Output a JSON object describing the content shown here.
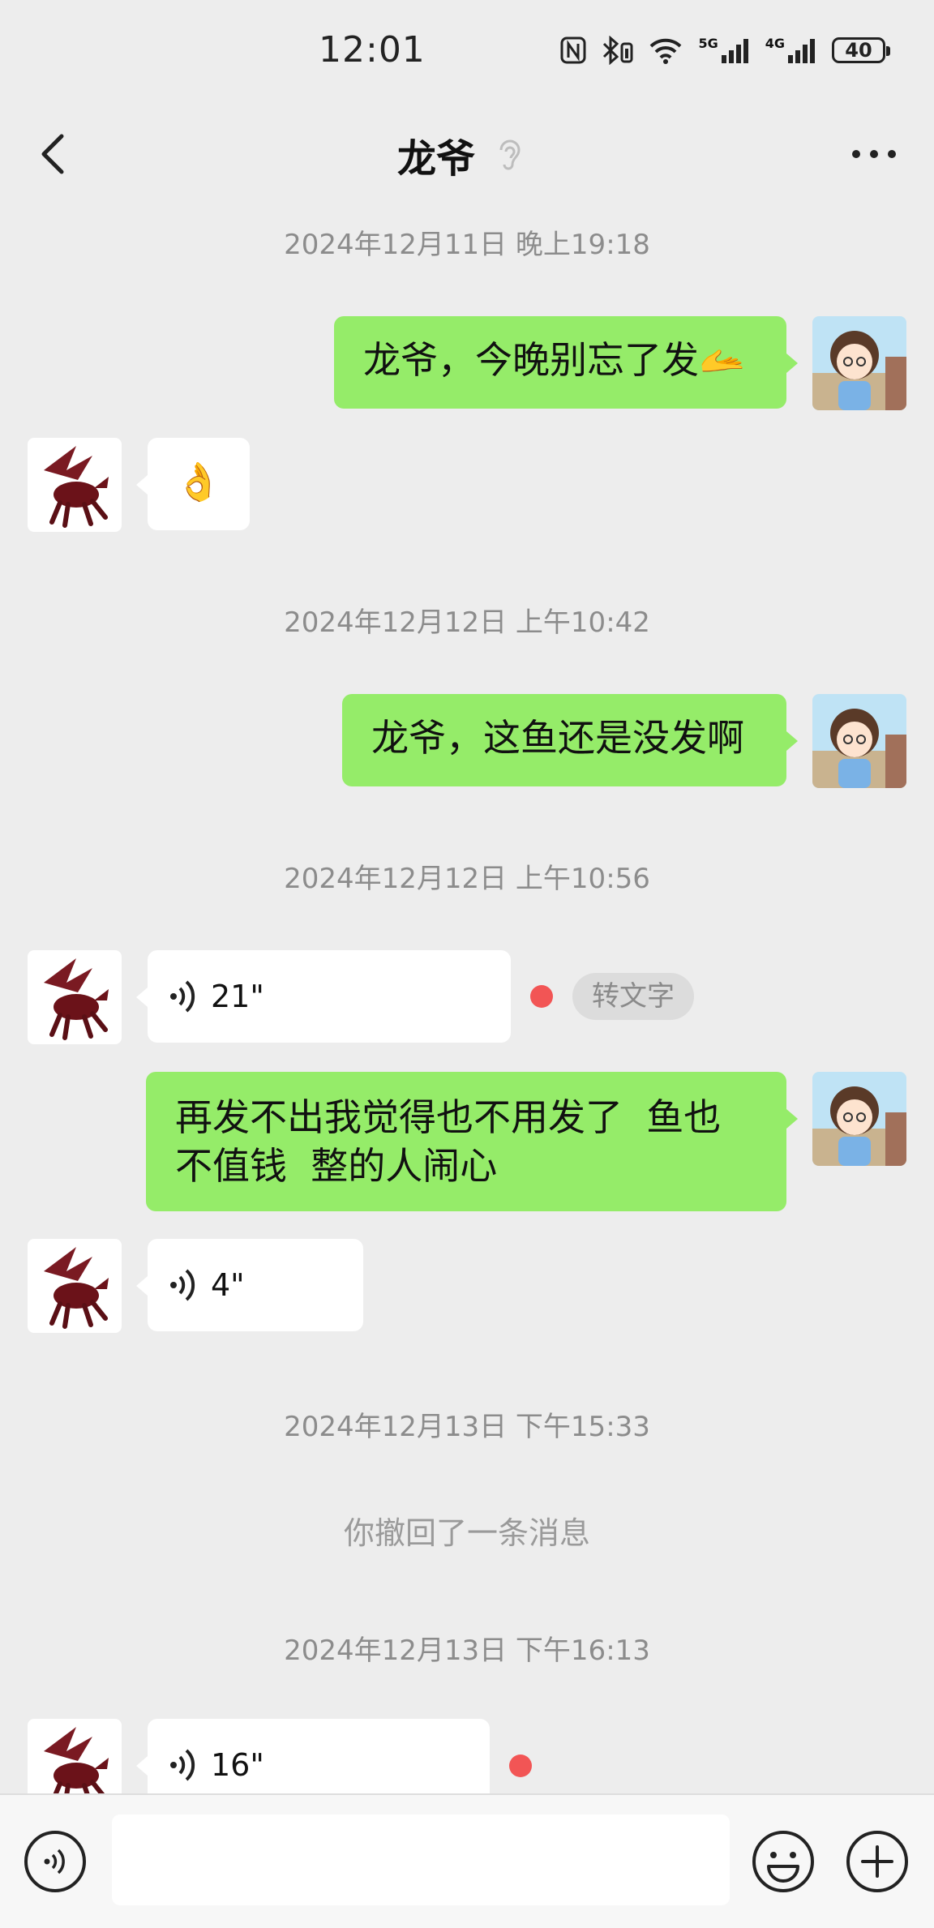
{
  "status_bar": {
    "time": "12:01",
    "net1": "5G",
    "net2": "4G",
    "battery": "40"
  },
  "header": {
    "title": "龙爷"
  },
  "messages": {
    "t1": "2024年12月11日 晚上19:18",
    "m1": "龙爷，今晚别忘了发🫴",
    "m2": "👌",
    "t2": "2024年12月12日 上午10:42",
    "m3": "龙爷，这鱼还是没发啊",
    "t3": "2024年12月12日 上午10:56",
    "v1": "21\"",
    "transcribe": "转文字",
    "m4_line1": "再发不出我觉得也不用发了  鱼也",
    "m4_line2": "不值钱  整的人闹心",
    "v2": "4\"",
    "t4": "2024年12月13日 下午15:33",
    "recall": "你撤回了一条消息",
    "t5": "2024年12月13日 下午16:13",
    "v3": "16\""
  },
  "input": {
    "placeholder": ""
  },
  "colors": {
    "out_bubble": "#95ec69",
    "in_bubble": "#ffffff",
    "background": "#ededed",
    "unread_dot": "#f25555"
  }
}
